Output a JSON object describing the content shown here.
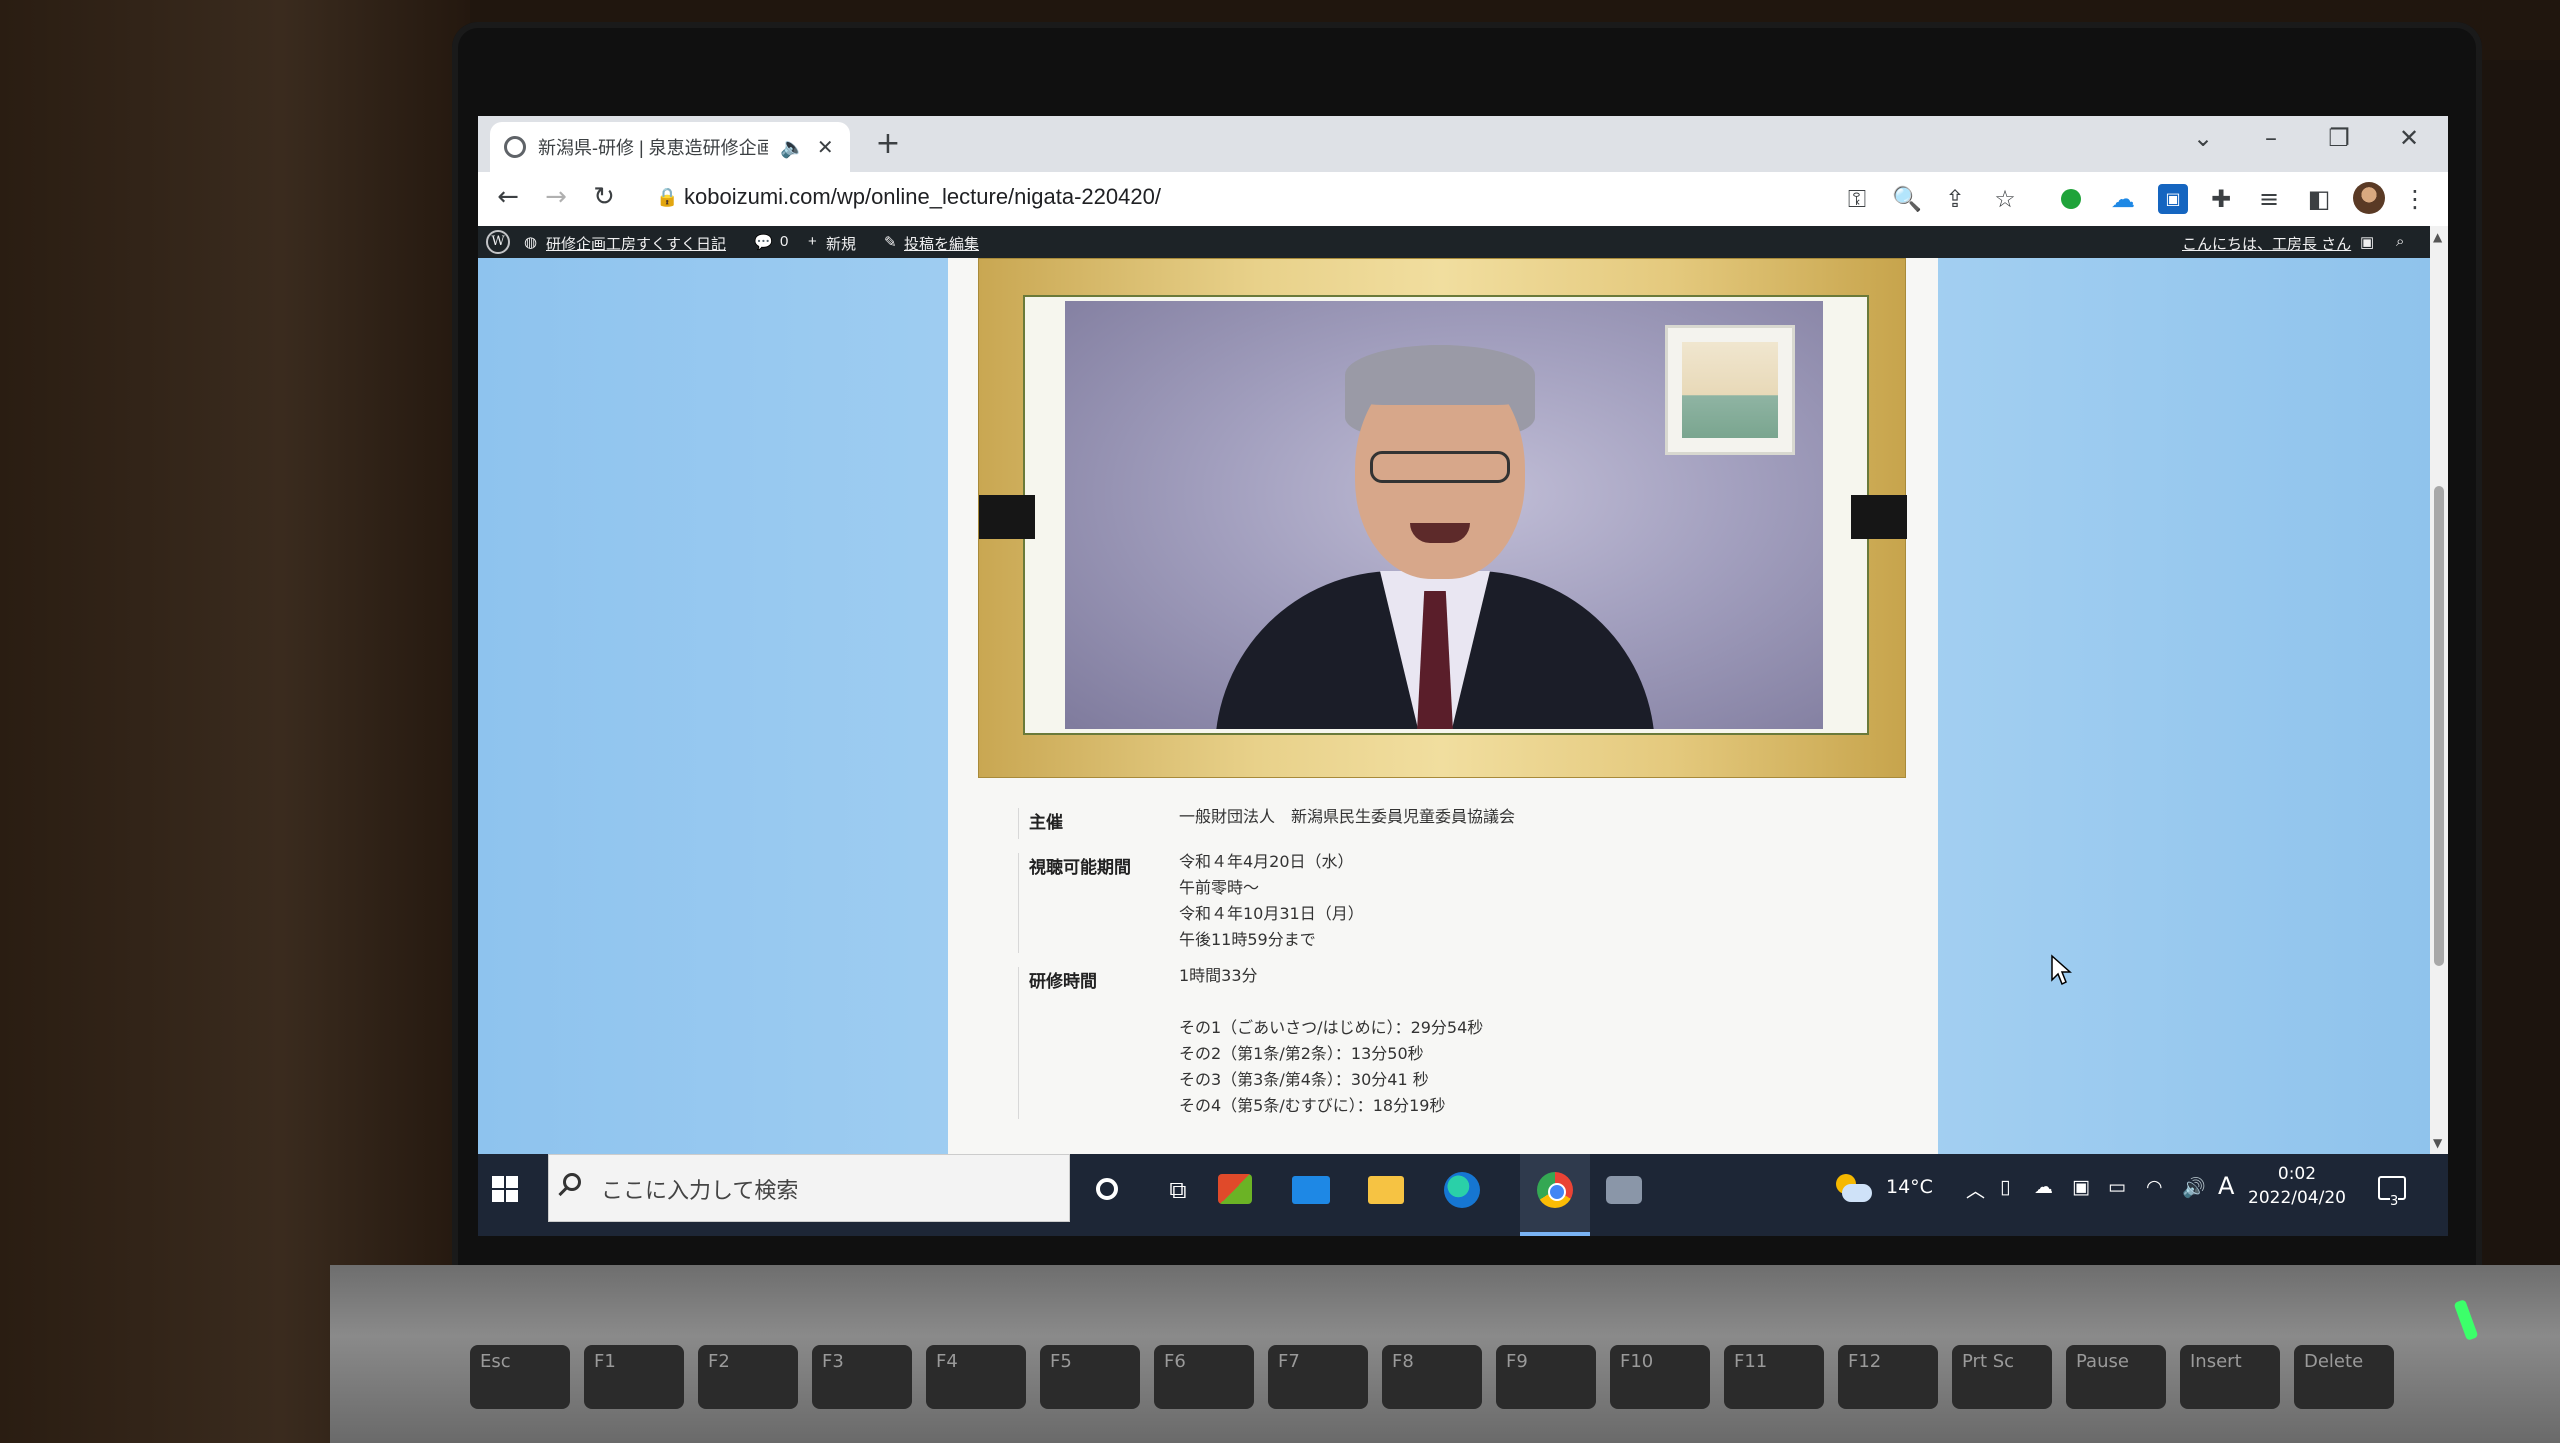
{
  "browser": {
    "tab_title": "新潟県-研修 | 泉恵造研修企画",
    "new_tab_label": "+",
    "url": "koboizumi.com/wp/online_lecture/nigata-220420/",
    "window_controls": [
      "chevron-down-icon",
      "minimize-icon",
      "restore-icon",
      "close-icon"
    ]
  },
  "adminbar": {
    "site_name": "研修企画工房すくすく日記",
    "comments_count": "0",
    "new_label": "新規",
    "edit_label": "投稿を編集",
    "greeting": "こんにちは、工房長 さん"
  },
  "info": {
    "rows": [
      {
        "label": "主催",
        "lines": [
          "一般財団法人　新潟県民生委員児童委員協議会"
        ]
      },
      {
        "label": "視聴可能期間",
        "lines": [
          "令和４年4月20日（水）",
          "午前零時～",
          "令和４年10月31日（月）",
          "午後11時59分まで"
        ]
      },
      {
        "label": "研修時間",
        "lines": [
          "1時間33分",
          "",
          "その1（ごあいさつ/はじめに）：29分54秒",
          "その2（第1条/第2条）：13分50秒",
          "その3（第3条/第4条）：30分41 秒",
          "その4（第5条/むすびに）：18分19秒"
        ]
      }
    ]
  },
  "taskbar": {
    "search_placeholder": "ここに入力して検索",
    "weather_temp": "14°C",
    "ime_label": "A",
    "time": "0:02",
    "date": "2022/04/20",
    "notification_count": "3"
  },
  "keyboard": {
    "keys": [
      "Esc",
      "F1",
      "F2",
      "F3",
      "F4",
      "F5",
      "F6",
      "F7",
      "F8",
      "F9",
      "F10",
      "F11",
      "F12",
      "Prt Sc",
      "Pause",
      "Insert",
      "Delete"
    ]
  },
  "colors": {
    "page_background": "#a6d1f2",
    "adminbar": "#1d2327",
    "taskbar": "#1d2636"
  }
}
